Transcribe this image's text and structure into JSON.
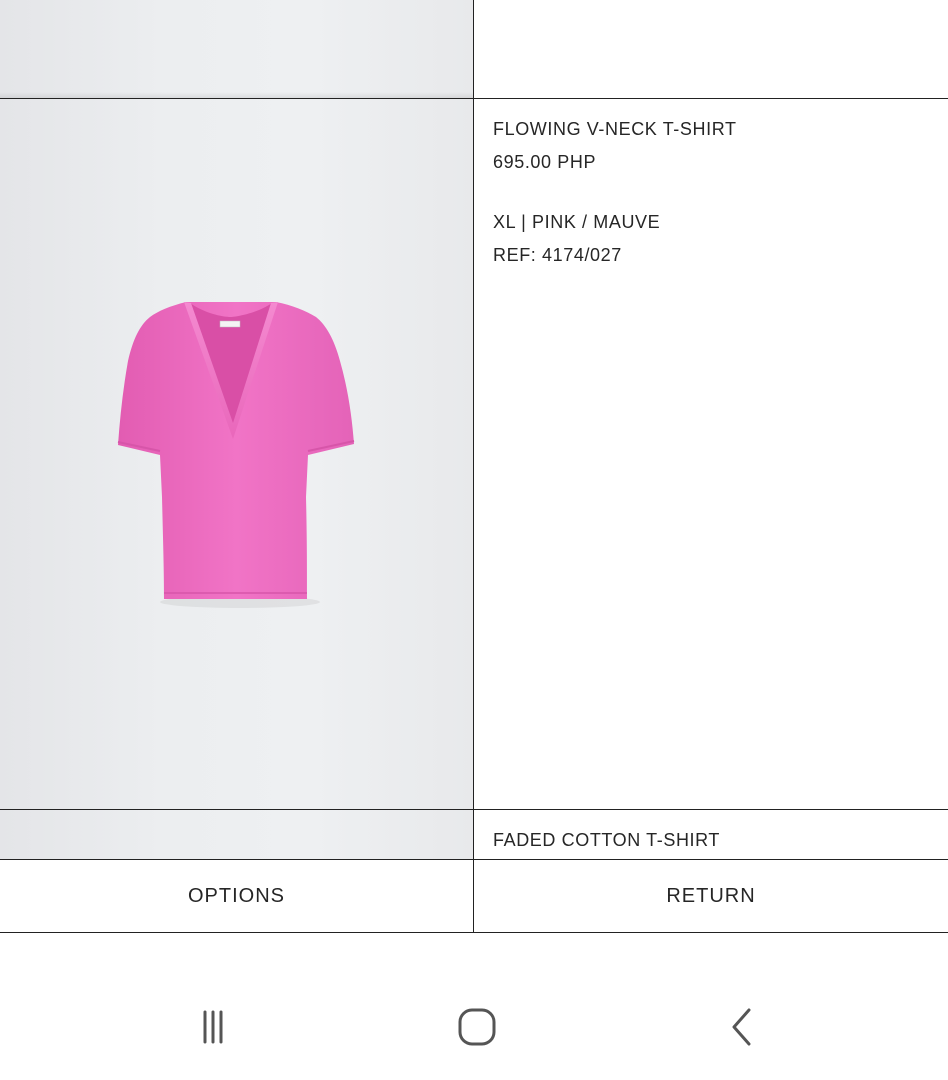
{
  "product": {
    "title": "FLOWING V-NECK T-SHIRT",
    "price": "695.00 PHP",
    "variant": "XL | PINK / MAUVE",
    "ref": "REF: 4174/027",
    "color": "#ef6fc1"
  },
  "next_product": {
    "title": "FADED COTTON T-SHIRT"
  },
  "actions": {
    "options_label": "OPTIONS",
    "return_label": "RETURN"
  },
  "system_nav": {
    "recents_icon": "recent-apps-icon",
    "home_icon": "home-icon",
    "back_icon": "back-icon"
  }
}
